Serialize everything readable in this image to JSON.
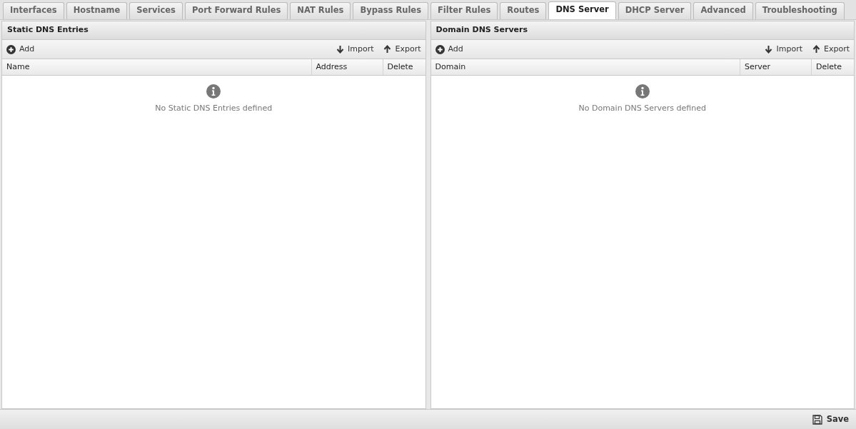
{
  "tabs": [
    {
      "label": "Interfaces",
      "selected": false
    },
    {
      "label": "Hostname",
      "selected": false
    },
    {
      "label": "Services",
      "selected": false
    },
    {
      "label": "Port Forward Rules",
      "selected": false
    },
    {
      "label": "NAT Rules",
      "selected": false
    },
    {
      "label": "Bypass Rules",
      "selected": false
    },
    {
      "label": "Filter Rules",
      "selected": false
    },
    {
      "label": "Routes",
      "selected": false
    },
    {
      "label": "DNS Server",
      "selected": true
    },
    {
      "label": "DHCP Server",
      "selected": false
    },
    {
      "label": "Advanced",
      "selected": false
    },
    {
      "label": "Troubleshooting",
      "selected": false
    }
  ],
  "panels": [
    {
      "title": "Static DNS Entries",
      "toolbar": {
        "add": "Add",
        "import": "Import",
        "export": "Export"
      },
      "columns": [
        "Name",
        "Address",
        "Delete"
      ],
      "empty_message": "No Static DNS Entries defined"
    },
    {
      "title": "Domain DNS Servers",
      "toolbar": {
        "add": "Add",
        "import": "Import",
        "export": "Export"
      },
      "columns": [
        "Domain",
        "Server",
        "Delete"
      ],
      "empty_message": "No Domain DNS Servers defined"
    }
  ],
  "footer": {
    "save": "Save"
  }
}
